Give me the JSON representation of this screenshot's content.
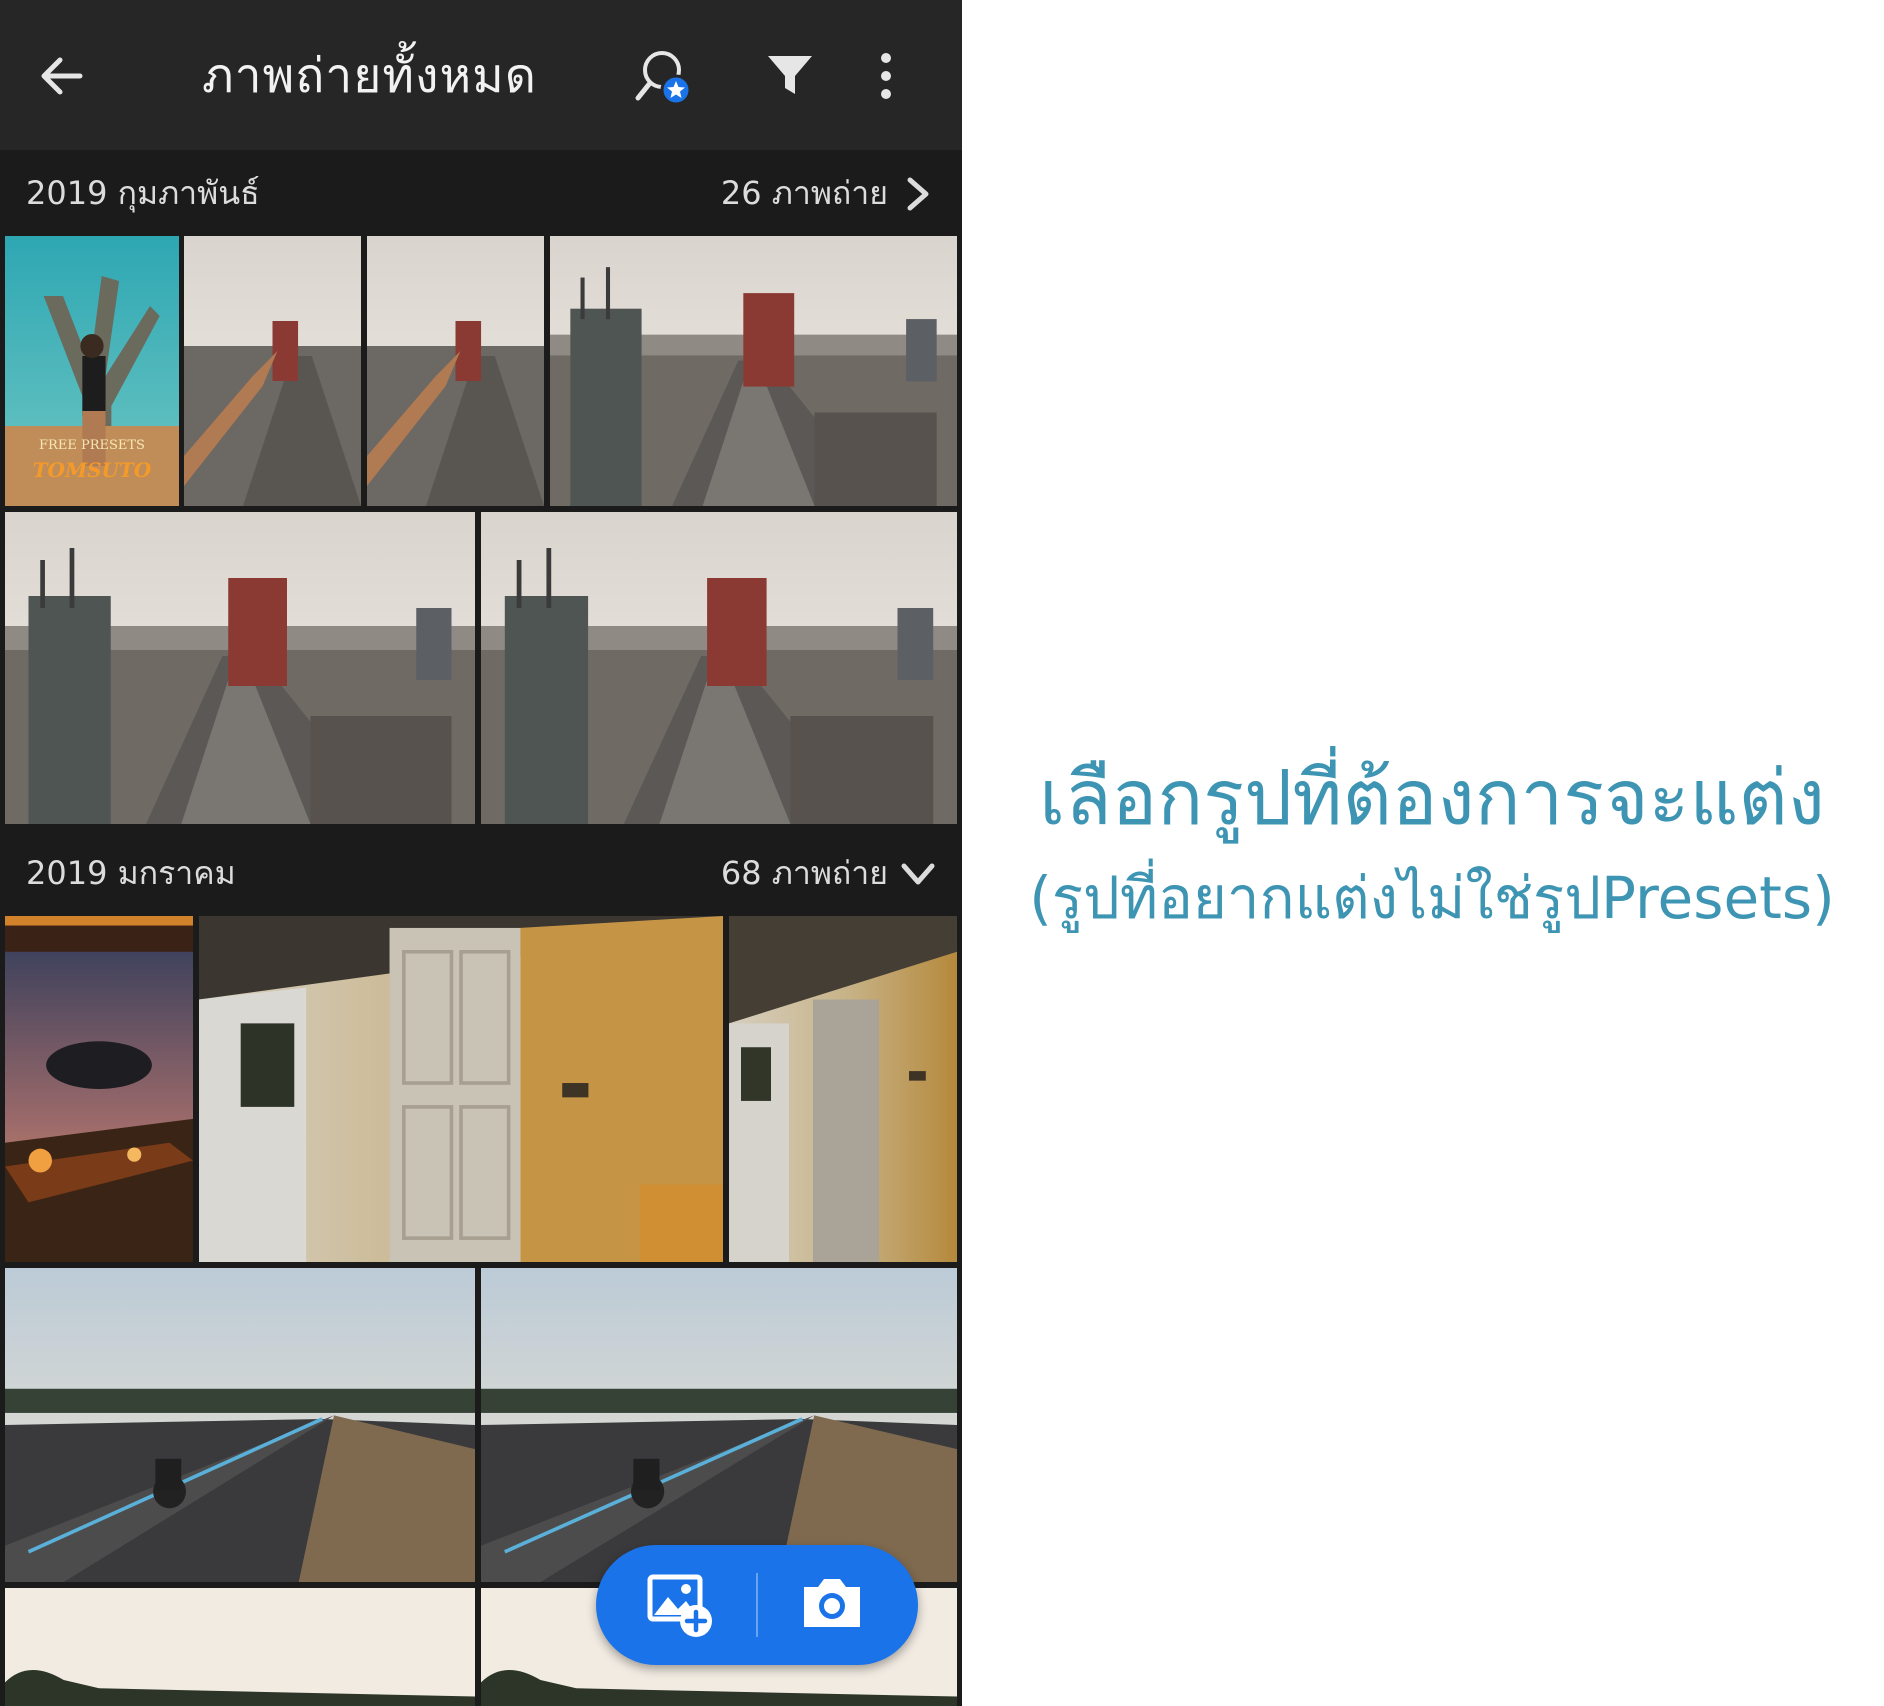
{
  "appbar": {
    "title": "ภาพถ่ายทั้งหมด",
    "icons": [
      "back-arrow-icon",
      "people-search-star-icon",
      "filter-icon",
      "more-vert-icon"
    ]
  },
  "sections": [
    {
      "date": "2019 กุมภาพันธ์",
      "count": "26 ภาพถ่าย",
      "expand_icon": "chevron-right-icon"
    },
    {
      "date": "2019 มกราคม",
      "count": "68 ภาพถ่าย",
      "expand_icon": "chevron-down-icon"
    }
  ],
  "thumbnail_watermark": {
    "line1": "FREE PRESETS",
    "line2": "TOMSUTO"
  },
  "fab": {
    "icons": [
      "add-photo-icon",
      "camera-icon"
    ],
    "color": "#1a73e8"
  },
  "caption": {
    "main": "เลือกรูปที่ต้องการจะแต่ง",
    "sub": "(รูปที่อยากแต่งไม่ใช่รูปPresets)",
    "color": "#3d95b3"
  }
}
